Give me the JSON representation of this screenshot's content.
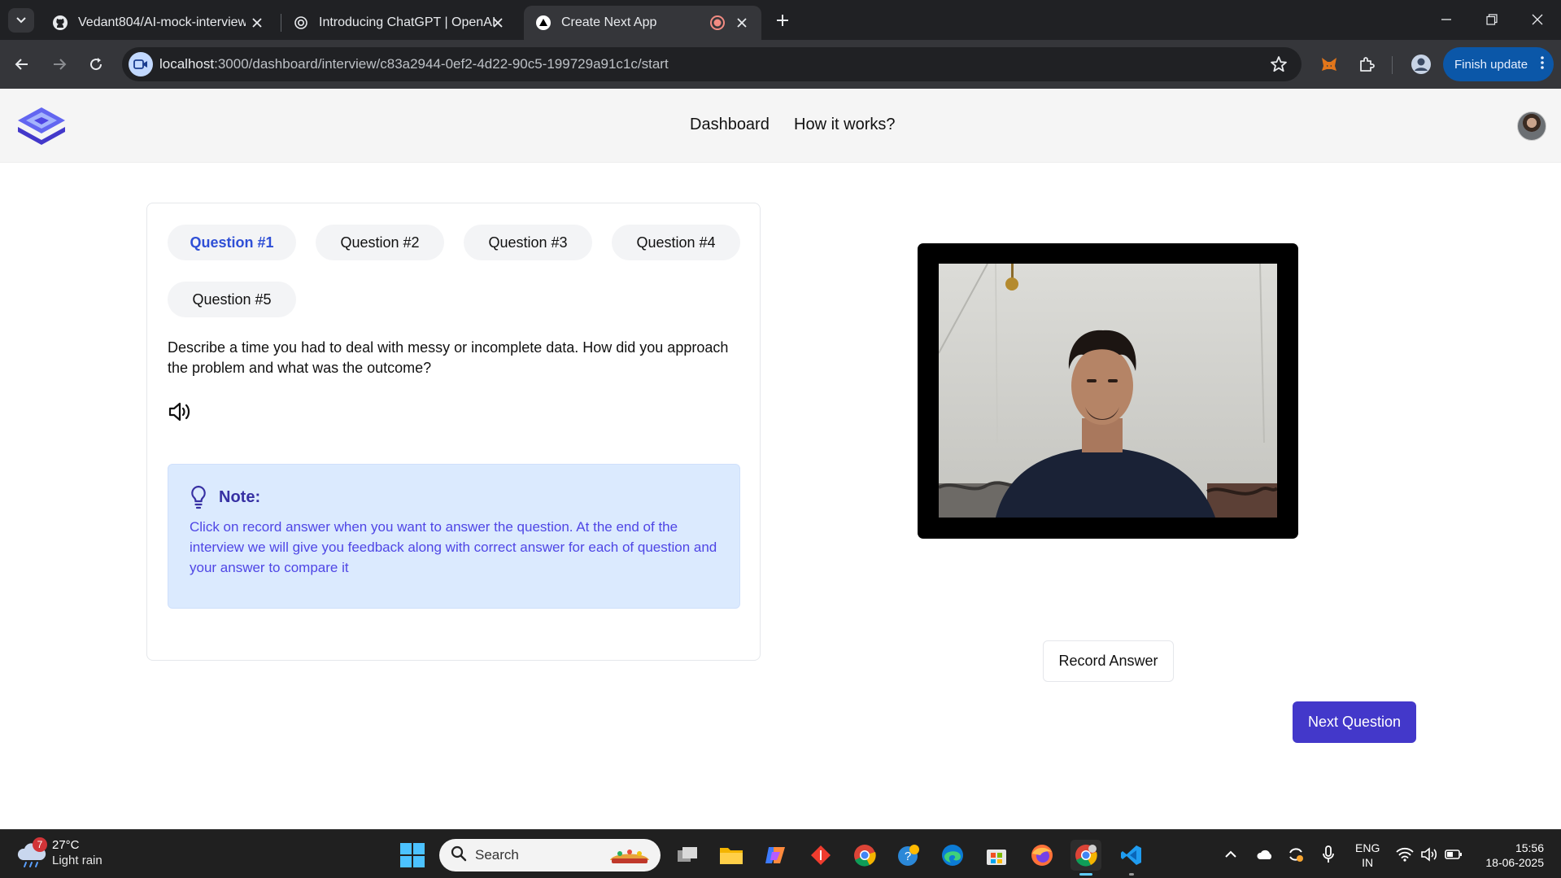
{
  "browser": {
    "tabs": [
      {
        "title": "Vedant804/AI-mock-interview-w",
        "favicon": "github-icon"
      },
      {
        "title": "Introducing ChatGPT | OpenAI",
        "favicon": "openai-icon"
      },
      {
        "title": "Create Next App",
        "favicon": "nextjs-icon",
        "recording": true
      }
    ],
    "url_host": "localhost",
    "url_path": ":3000/dashboard/interview/c83a2944-0ef2-4d22-90c5-199729a91c1c/start",
    "finish_update_label": "Finish update"
  },
  "header": {
    "nav": [
      "Dashboard",
      "How it works?"
    ]
  },
  "questions": {
    "tabs": [
      "Question #1",
      "Question #2",
      "Question #3",
      "Question #4",
      "Question #5"
    ],
    "active_index": 0,
    "text": "Describe a time you had to deal with messy or incomplete data. How did you approach the problem and what was the outcome?",
    "note_title": "Note:",
    "note_text": "Click on record answer when you want to answer the question. At the end of the interview we will give you feedback along with correct answer for each of question and your answer to compare it"
  },
  "actions": {
    "record_label": "Record Answer",
    "next_label": "Next Question"
  },
  "taskbar": {
    "weather_badge": "7",
    "temperature": "27°C",
    "condition": "Light rain",
    "search_placeholder": "Search",
    "lang_line1": "ENG",
    "lang_line2": "IN",
    "time": "15:56",
    "date": "18-06-2025"
  },
  "colors": {
    "accent": "#4338ca",
    "active_tab_text": "#2f4fd6",
    "note_bg": "#dbeafe",
    "note_title": "#3730a3",
    "note_text": "#4f46e5"
  }
}
